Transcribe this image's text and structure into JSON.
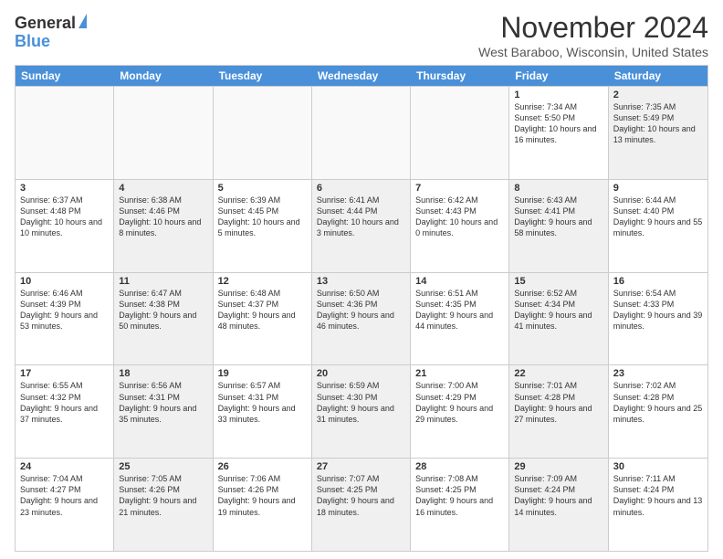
{
  "logo": {
    "line1": "General",
    "line2": "Blue"
  },
  "title": "November 2024",
  "subtitle": "West Baraboo, Wisconsin, United States",
  "headers": [
    "Sunday",
    "Monday",
    "Tuesday",
    "Wednesday",
    "Thursday",
    "Friday",
    "Saturday"
  ],
  "rows": [
    [
      {
        "day": "",
        "info": "",
        "empty": true
      },
      {
        "day": "",
        "info": "",
        "empty": true
      },
      {
        "day": "",
        "info": "",
        "empty": true
      },
      {
        "day": "",
        "info": "",
        "empty": true
      },
      {
        "day": "",
        "info": "",
        "empty": true
      },
      {
        "day": "1",
        "info": "Sunrise: 7:34 AM\nSunset: 5:50 PM\nDaylight: 10 hours and 16 minutes.",
        "shaded": false
      },
      {
        "day": "2",
        "info": "Sunrise: 7:35 AM\nSunset: 5:49 PM\nDaylight: 10 hours and 13 minutes.",
        "shaded": true
      }
    ],
    [
      {
        "day": "3",
        "info": "Sunrise: 6:37 AM\nSunset: 4:48 PM\nDaylight: 10 hours and 10 minutes.",
        "shaded": false
      },
      {
        "day": "4",
        "info": "Sunrise: 6:38 AM\nSunset: 4:46 PM\nDaylight: 10 hours and 8 minutes.",
        "shaded": true
      },
      {
        "day": "5",
        "info": "Sunrise: 6:39 AM\nSunset: 4:45 PM\nDaylight: 10 hours and 5 minutes.",
        "shaded": false
      },
      {
        "day": "6",
        "info": "Sunrise: 6:41 AM\nSunset: 4:44 PM\nDaylight: 10 hours and 3 minutes.",
        "shaded": true
      },
      {
        "day": "7",
        "info": "Sunrise: 6:42 AM\nSunset: 4:43 PM\nDaylight: 10 hours and 0 minutes.",
        "shaded": false
      },
      {
        "day": "8",
        "info": "Sunrise: 6:43 AM\nSunset: 4:41 PM\nDaylight: 9 hours and 58 minutes.",
        "shaded": true
      },
      {
        "day": "9",
        "info": "Sunrise: 6:44 AM\nSunset: 4:40 PM\nDaylight: 9 hours and 55 minutes.",
        "shaded": false
      }
    ],
    [
      {
        "day": "10",
        "info": "Sunrise: 6:46 AM\nSunset: 4:39 PM\nDaylight: 9 hours and 53 minutes.",
        "shaded": false
      },
      {
        "day": "11",
        "info": "Sunrise: 6:47 AM\nSunset: 4:38 PM\nDaylight: 9 hours and 50 minutes.",
        "shaded": true
      },
      {
        "day": "12",
        "info": "Sunrise: 6:48 AM\nSunset: 4:37 PM\nDaylight: 9 hours and 48 minutes.",
        "shaded": false
      },
      {
        "day": "13",
        "info": "Sunrise: 6:50 AM\nSunset: 4:36 PM\nDaylight: 9 hours and 46 minutes.",
        "shaded": true
      },
      {
        "day": "14",
        "info": "Sunrise: 6:51 AM\nSunset: 4:35 PM\nDaylight: 9 hours and 44 minutes.",
        "shaded": false
      },
      {
        "day": "15",
        "info": "Sunrise: 6:52 AM\nSunset: 4:34 PM\nDaylight: 9 hours and 41 minutes.",
        "shaded": true
      },
      {
        "day": "16",
        "info": "Sunrise: 6:54 AM\nSunset: 4:33 PM\nDaylight: 9 hours and 39 minutes.",
        "shaded": false
      }
    ],
    [
      {
        "day": "17",
        "info": "Sunrise: 6:55 AM\nSunset: 4:32 PM\nDaylight: 9 hours and 37 minutes.",
        "shaded": false
      },
      {
        "day": "18",
        "info": "Sunrise: 6:56 AM\nSunset: 4:31 PM\nDaylight: 9 hours and 35 minutes.",
        "shaded": true
      },
      {
        "day": "19",
        "info": "Sunrise: 6:57 AM\nSunset: 4:31 PM\nDaylight: 9 hours and 33 minutes.",
        "shaded": false
      },
      {
        "day": "20",
        "info": "Sunrise: 6:59 AM\nSunset: 4:30 PM\nDaylight: 9 hours and 31 minutes.",
        "shaded": true
      },
      {
        "day": "21",
        "info": "Sunrise: 7:00 AM\nSunset: 4:29 PM\nDaylight: 9 hours and 29 minutes.",
        "shaded": false
      },
      {
        "day": "22",
        "info": "Sunrise: 7:01 AM\nSunset: 4:28 PM\nDaylight: 9 hours and 27 minutes.",
        "shaded": true
      },
      {
        "day": "23",
        "info": "Sunrise: 7:02 AM\nSunset: 4:28 PM\nDaylight: 9 hours and 25 minutes.",
        "shaded": false
      }
    ],
    [
      {
        "day": "24",
        "info": "Sunrise: 7:04 AM\nSunset: 4:27 PM\nDaylight: 9 hours and 23 minutes.",
        "shaded": false
      },
      {
        "day": "25",
        "info": "Sunrise: 7:05 AM\nSunset: 4:26 PM\nDaylight: 9 hours and 21 minutes.",
        "shaded": true
      },
      {
        "day": "26",
        "info": "Sunrise: 7:06 AM\nSunset: 4:26 PM\nDaylight: 9 hours and 19 minutes.",
        "shaded": false
      },
      {
        "day": "27",
        "info": "Sunrise: 7:07 AM\nSunset: 4:25 PM\nDaylight: 9 hours and 18 minutes.",
        "shaded": true
      },
      {
        "day": "28",
        "info": "Sunrise: 7:08 AM\nSunset: 4:25 PM\nDaylight: 9 hours and 16 minutes.",
        "shaded": false
      },
      {
        "day": "29",
        "info": "Sunrise: 7:09 AM\nSunset: 4:24 PM\nDaylight: 9 hours and 14 minutes.",
        "shaded": true
      },
      {
        "day": "30",
        "info": "Sunrise: 7:11 AM\nSunset: 4:24 PM\nDaylight: 9 hours and 13 minutes.",
        "shaded": false
      }
    ]
  ]
}
